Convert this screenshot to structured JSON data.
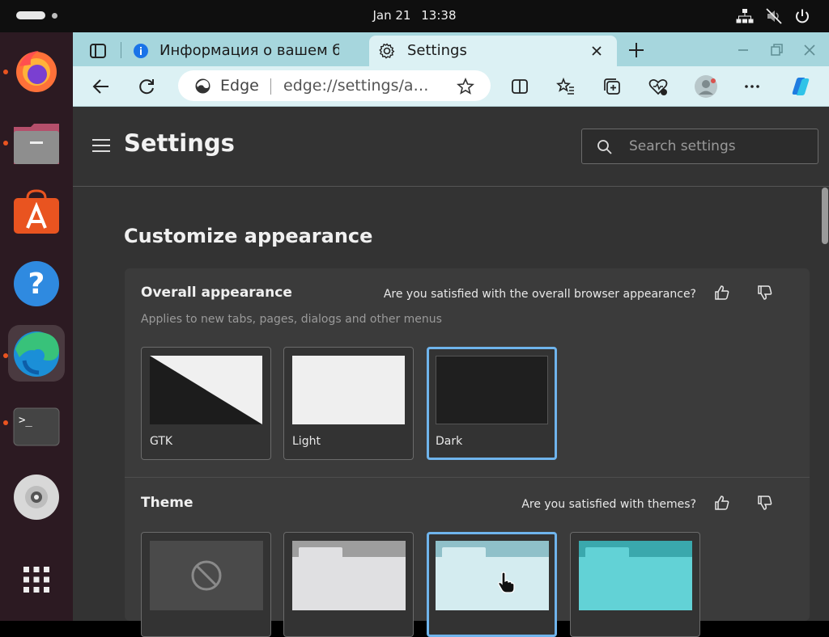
{
  "system": {
    "date": "Jan 21",
    "time": "13:38",
    "tray_icons": [
      "network-icon",
      "volume-muted-icon",
      "power-icon"
    ]
  },
  "dock": {
    "items": [
      "firefox-icon",
      "files-icon",
      "app-center-icon",
      "help-icon",
      "edge-icon",
      "terminal-icon",
      "disc-icon",
      "show-apps-icon"
    ],
    "running": [
      "firefox-icon",
      "files-icon",
      "edge-icon",
      "terminal-icon"
    ],
    "active": "edge-icon",
    "accent": "#e95420"
  },
  "browser": {
    "tabs": [
      {
        "title": "Информация о вашем бр",
        "icon": "info-icon",
        "active": false
      },
      {
        "title": "Settings",
        "icon": "gear-icon",
        "active": true
      }
    ],
    "address": {
      "site_label": "Edge",
      "url": "edge://settings/a…"
    },
    "colors": {
      "tabstrip": "#a6d6dd",
      "toolbar": "#dcf1f4"
    }
  },
  "settings": {
    "title": "Settings",
    "search_placeholder": "Search settings",
    "section_title": "Customize appearance",
    "overall": {
      "heading": "Overall appearance",
      "subtext": "Applies to new tabs, pages, dialogs and other menus",
      "feedback": "Are you satisfied with the overall browser appearance?",
      "options": [
        {
          "label": "GTK",
          "selected": false
        },
        {
          "label": "Light",
          "selected": false
        },
        {
          "label": "Dark",
          "selected": true
        }
      ]
    },
    "theme": {
      "heading": "Theme",
      "feedback": "Are you satisfied with themes?",
      "options": [
        {
          "name": "none",
          "selected": false
        },
        {
          "name": "gray",
          "selected": false
        },
        {
          "name": "light-blue",
          "selected": true
        },
        {
          "name": "cyan",
          "selected": false
        }
      ]
    },
    "accent": "#6fb4ec"
  }
}
